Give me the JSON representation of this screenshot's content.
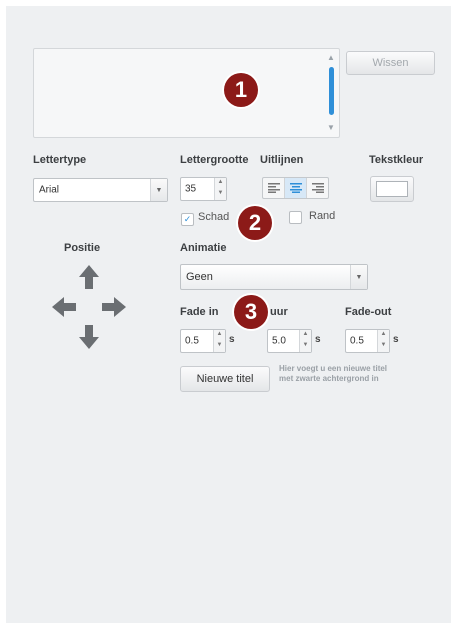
{
  "text_input": {
    "value": ""
  },
  "buttons": {
    "clear": "Wissen",
    "new_title": "Nieuwe titel"
  },
  "font": {
    "label": "Lettertype",
    "value": "Arial"
  },
  "font_size": {
    "label": "Lettergrootte",
    "value": "35"
  },
  "alignment": {
    "label": "Uitlijnen",
    "options": [
      "left-align-icon",
      "center-align-icon",
      "right-align-icon"
    ],
    "selected": "center"
  },
  "text_color": {
    "label": "Tekstkleur",
    "value": "#ffffff"
  },
  "shadow": {
    "label": "Schad",
    "checked": true
  },
  "border": {
    "label": "Rand",
    "checked": false
  },
  "position": {
    "label": "Positie"
  },
  "animation": {
    "label": "Animatie",
    "value": "Geen"
  },
  "fade_in": {
    "label": "Fade in",
    "value": "0.5",
    "unit": "s"
  },
  "duration": {
    "label": "uur",
    "value": "5.0",
    "unit": "s"
  },
  "fade_out": {
    "label": "Fade-out",
    "value": "0.5",
    "unit": "s"
  },
  "hint": {
    "line1": "Hier voegt u een nieuwe titel",
    "line2": "met zwarte achtergrond in"
  },
  "badges": [
    "1",
    "2",
    "3"
  ],
  "colors": {
    "accent": "#2f8fd8",
    "badge": "#8c1a18",
    "panel": "#eef0f2",
    "arrows": "#6a6e72"
  }
}
